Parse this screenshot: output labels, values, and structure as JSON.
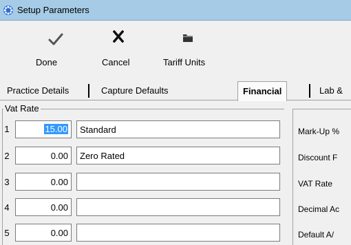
{
  "window": {
    "title": "Setup Parameters",
    "icon": "gear-icon"
  },
  "toolbar": {
    "done_label": "Done",
    "cancel_label": "Cancel",
    "tariff_label": "Tariff Units",
    "done_icon": "checkmark-icon",
    "cancel_icon": "x-icon",
    "tariff_icon": "folder-icon"
  },
  "tabs": [
    {
      "label": "Practice Details",
      "active": false
    },
    {
      "label": "Capture Defaults",
      "active": false
    },
    {
      "label": "Financial",
      "active": true
    },
    {
      "label": "Lab &",
      "active": false
    }
  ],
  "vat_group": {
    "legend": "Vat Rate",
    "rows": [
      {
        "num": "1",
        "rate": "15.00",
        "desc": "Standard"
      },
      {
        "num": "2",
        "rate": "0.00",
        "desc": "Zero Rated"
      },
      {
        "num": "3",
        "rate": "0.00",
        "desc": ""
      },
      {
        "num": "4",
        "rate": "0.00",
        "desc": ""
      },
      {
        "num": "5",
        "rate": "0.00",
        "desc": ""
      }
    ]
  },
  "right_panel": {
    "labels": [
      "Mark-Up %",
      "Discount F",
      "VAT Rate",
      "Decimal Ac",
      "Default A/"
    ]
  },
  "colors": {
    "titlebar": "#a6cbe6",
    "selection": "#3399ff"
  }
}
